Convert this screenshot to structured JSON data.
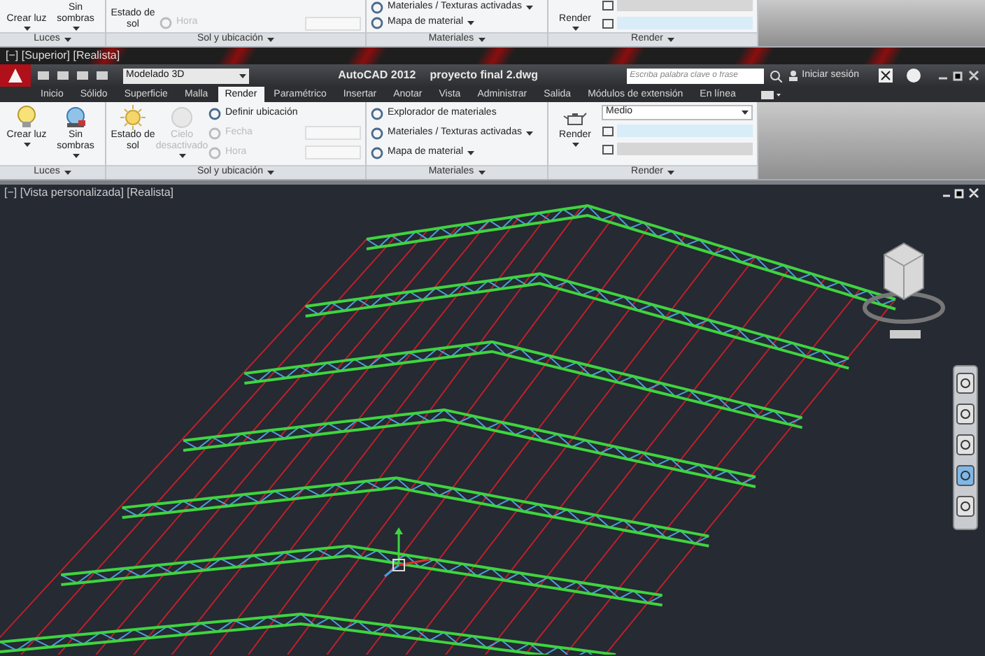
{
  "upper_ribbon": {
    "panels": [
      {
        "label": "Luces",
        "items": [
          {
            "kind": "large",
            "label": "Crear luz",
            "menu": true
          },
          {
            "kind": "large",
            "label": "Sin sombras",
            "menu": true
          }
        ]
      },
      {
        "label": "Sol y ubicación",
        "items": [
          {
            "kind": "large",
            "label": "Estado de sol",
            "menu": false
          },
          {
            "kind": "small",
            "label": "Hora",
            "disabled": true,
            "field": true
          }
        ]
      },
      {
        "label": "Materiales",
        "items": [
          {
            "kind": "small",
            "label": "Materiales / Texturas activadas",
            "menu": true
          },
          {
            "kind": "small",
            "label": "Mapa de material",
            "menu": true
          }
        ]
      },
      {
        "label": "Render",
        "items": [
          {
            "kind": "large",
            "label": "Render",
            "menu": true
          },
          {
            "kind": "bar"
          },
          {
            "kind": "bar"
          }
        ]
      }
    ]
  },
  "drawing_label": "[−] [Superior] [Realista]",
  "title_bar": {
    "workspace": "Modelado 3D",
    "app": "AutoCAD 2012",
    "file": "proyecto final 2.dwg",
    "search_placeholder": "Escriba palabra clave o frase",
    "sign_in": "Iniciar sesión"
  },
  "tabs": [
    {
      "label": "Inicio",
      "selected": false
    },
    {
      "label": "Sólido",
      "selected": false
    },
    {
      "label": "Superficie",
      "selected": false
    },
    {
      "label": "Malla",
      "selected": false
    },
    {
      "label": "Render",
      "selected": true
    },
    {
      "label": "Paramétrico",
      "selected": false
    },
    {
      "label": "Insertar",
      "selected": false
    },
    {
      "label": "Anotar",
      "selected": false
    },
    {
      "label": "Vista",
      "selected": false
    },
    {
      "label": "Administrar",
      "selected": false
    },
    {
      "label": "Salida",
      "selected": false
    },
    {
      "label": "Módulos de extensión",
      "selected": false
    },
    {
      "label": "En línea",
      "selected": false
    }
  ],
  "ribbon": {
    "panels": [
      {
        "label": "Luces",
        "items": [
          {
            "kind": "large",
            "label": "Crear luz",
            "menu": true
          },
          {
            "kind": "large",
            "label": "Sin sombras",
            "menu": true
          }
        ]
      },
      {
        "label": "Sol y ubicación",
        "items": [
          {
            "kind": "large",
            "label": "Estado de sol",
            "menu": false
          },
          {
            "kind": "large",
            "label": "Cielo desactivado",
            "menu": true,
            "disabled": true
          },
          {
            "kind": "small",
            "label": "Definir ubicación",
            "disabled": false
          },
          {
            "kind": "small",
            "label": "Fecha",
            "disabled": true,
            "field": true
          },
          {
            "kind": "small",
            "label": "Hora",
            "disabled": true,
            "field": true
          }
        ]
      },
      {
        "label": "Materiales",
        "items": [
          {
            "kind": "small",
            "label": "Explorador de materiales",
            "menu": false
          },
          {
            "kind": "small",
            "label": "Materiales / Texturas activadas",
            "menu": true
          },
          {
            "kind": "small",
            "label": "Mapa de material",
            "menu": true
          }
        ]
      },
      {
        "label": "Render",
        "items": [
          {
            "kind": "large",
            "label": "Render",
            "menu": true
          },
          {
            "kind": "select",
            "value": "Medio"
          },
          {
            "kind": "bar"
          },
          {
            "kind": "bar"
          }
        ]
      }
    ]
  },
  "viewport": {
    "label": "[−] [Vista personalizada] [Realista]"
  }
}
